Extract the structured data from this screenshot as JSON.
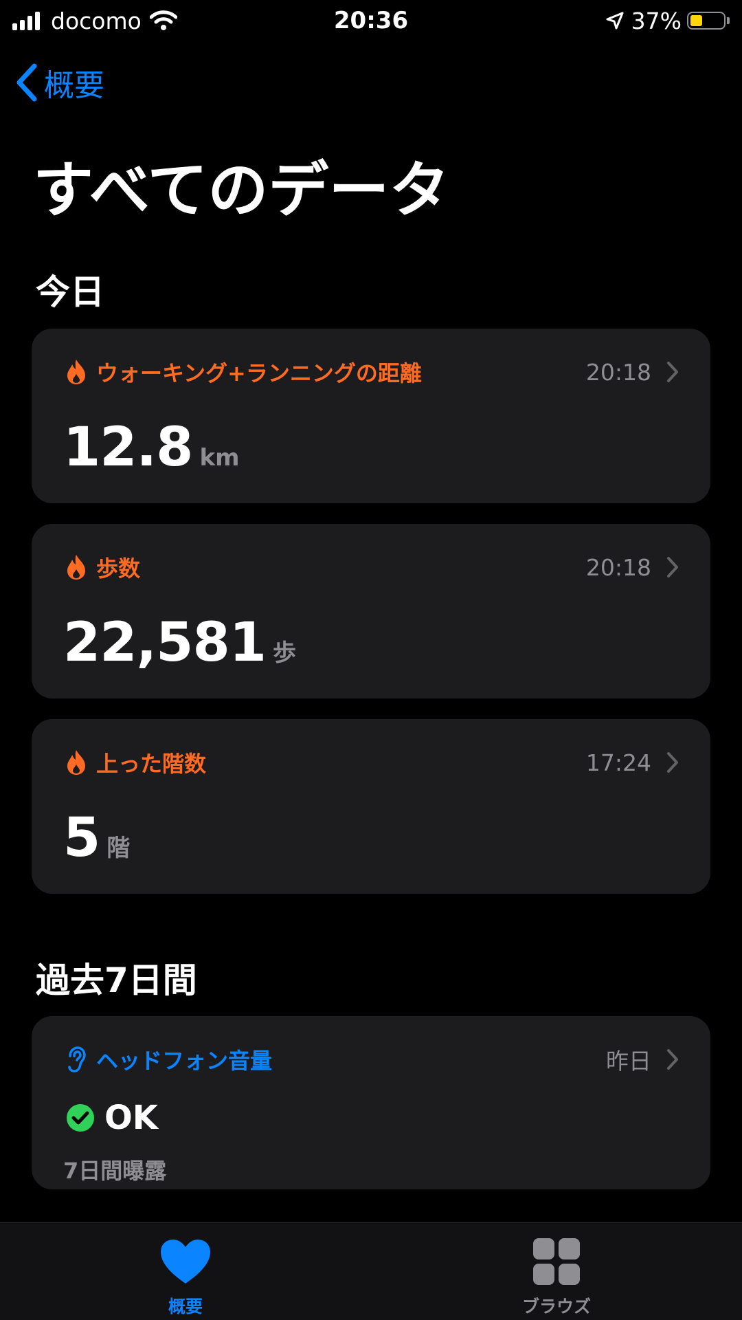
{
  "status_bar": {
    "carrier": "docomo",
    "time": "20:36",
    "battery": "37%",
    "battery_level": 0.37,
    "battery_color": "#ffd60a"
  },
  "nav": {
    "back_label": "概要"
  },
  "title": "すべてのデータ",
  "sections": {
    "today": {
      "header": "今日",
      "cards": [
        {
          "icon": "flame-icon",
          "title": "ウォーキング+ランニングの距離",
          "time": "20:18",
          "value": "12.8",
          "unit": "km"
        },
        {
          "icon": "flame-icon",
          "title": "歩数",
          "time": "20:18",
          "value": "22,581",
          "unit": "歩"
        },
        {
          "icon": "flame-icon",
          "title": "上った階数",
          "time": "17:24",
          "value": "5",
          "unit": "階"
        }
      ]
    },
    "past_week": {
      "header": "過去7日間",
      "card": {
        "icon": "ear-icon",
        "title": "ヘッドフォン音量",
        "time": "昨日",
        "status": "OK",
        "subtitle": "7日間曝露"
      }
    }
  },
  "tab_bar": {
    "items": [
      {
        "icon": "heart-icon",
        "label": "概要",
        "active": true
      },
      {
        "icon": "browse-grid-icon",
        "label": "ブラウズ",
        "active": false
      }
    ]
  },
  "colors": {
    "accent_blue": "#0a84ff",
    "activity_orange": "#ff6b22",
    "ok_green": "#30d158",
    "card_bg": "#1c1c1e",
    "secondary_text": "#8e8e93"
  }
}
